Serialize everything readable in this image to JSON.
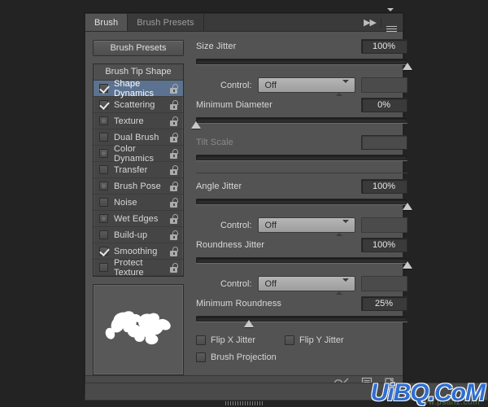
{
  "window": {
    "tabs": [
      {
        "label": "Brush",
        "active": true
      },
      {
        "label": "Brush Presets",
        "active": false
      }
    ],
    "collapse_icon": "double-chevron-right-icon",
    "menu_icon": "panel-menu-icon"
  },
  "left": {
    "presets_button": "Brush Presets",
    "list_header": "Brush Tip Shape",
    "options": [
      {
        "label": "Shape Dynamics",
        "checked": true,
        "selected": true,
        "locked": false
      },
      {
        "label": "Scattering",
        "checked": true,
        "selected": false,
        "locked": false
      },
      {
        "label": "Texture",
        "checked": false,
        "selected": false,
        "locked": false
      },
      {
        "label": "Dual Brush",
        "checked": false,
        "selected": false,
        "locked": false
      },
      {
        "label": "Color Dynamics",
        "checked": false,
        "selected": false,
        "locked": false
      },
      {
        "label": "Transfer",
        "checked": false,
        "selected": false,
        "locked": false
      },
      {
        "label": "Brush Pose",
        "checked": false,
        "selected": false,
        "locked": false
      },
      {
        "label": "Noise",
        "checked": false,
        "selected": false,
        "locked": false
      },
      {
        "label": "Wet Edges",
        "checked": false,
        "selected": false,
        "locked": false
      },
      {
        "label": "Build-up",
        "checked": false,
        "selected": false,
        "locked": false
      },
      {
        "label": "Smoothing",
        "checked": true,
        "selected": false,
        "locked": false
      },
      {
        "label": "Protect Texture",
        "checked": false,
        "selected": false,
        "locked": false
      }
    ],
    "preview_name": "brush-stroke-preview"
  },
  "right": {
    "size_jitter": {
      "label": "Size Jitter",
      "value": "100%",
      "percent": 100
    },
    "size_control": {
      "label": "Control:",
      "value": "Off"
    },
    "minimum_diameter": {
      "label": "Minimum Diameter",
      "value": "0%",
      "percent": 0
    },
    "tilt_scale": {
      "label": "Tilt Scale",
      "value": "",
      "percent": 0,
      "disabled": true
    },
    "angle_jitter": {
      "label": "Angle Jitter",
      "value": "100%",
      "percent": 100
    },
    "angle_control": {
      "label": "Control:",
      "value": "Off"
    },
    "roundness_jitter": {
      "label": "Roundness Jitter",
      "value": "100%",
      "percent": 100
    },
    "roundness_control": {
      "label": "Control:",
      "value": "Off"
    },
    "minimum_roundness": {
      "label": "Minimum Roundness",
      "value": "25%",
      "percent": 25
    },
    "flip_x": {
      "label": "Flip X Jitter",
      "checked": false
    },
    "flip_y": {
      "label": "Flip Y Jitter",
      "checked": false
    },
    "brush_projection": {
      "label": "Brush Projection",
      "checked": false
    }
  },
  "footer": {
    "toggle_icon": "brush-toggle-icon",
    "new_brush_icon": "new-brush-icon",
    "delete_icon": "delete-brush-icon"
  },
  "watermark": {
    "text": "UiBQ.CoM",
    "sub": "www.psahz.com"
  },
  "colors": {
    "panel_bg": "#535353",
    "tab_inactive": "#3a3a3a",
    "selection": "#5b7391",
    "text": "#d8d8d8",
    "value_field": "#3a3a3a",
    "watermark_blue": "#2f6fd0"
  }
}
